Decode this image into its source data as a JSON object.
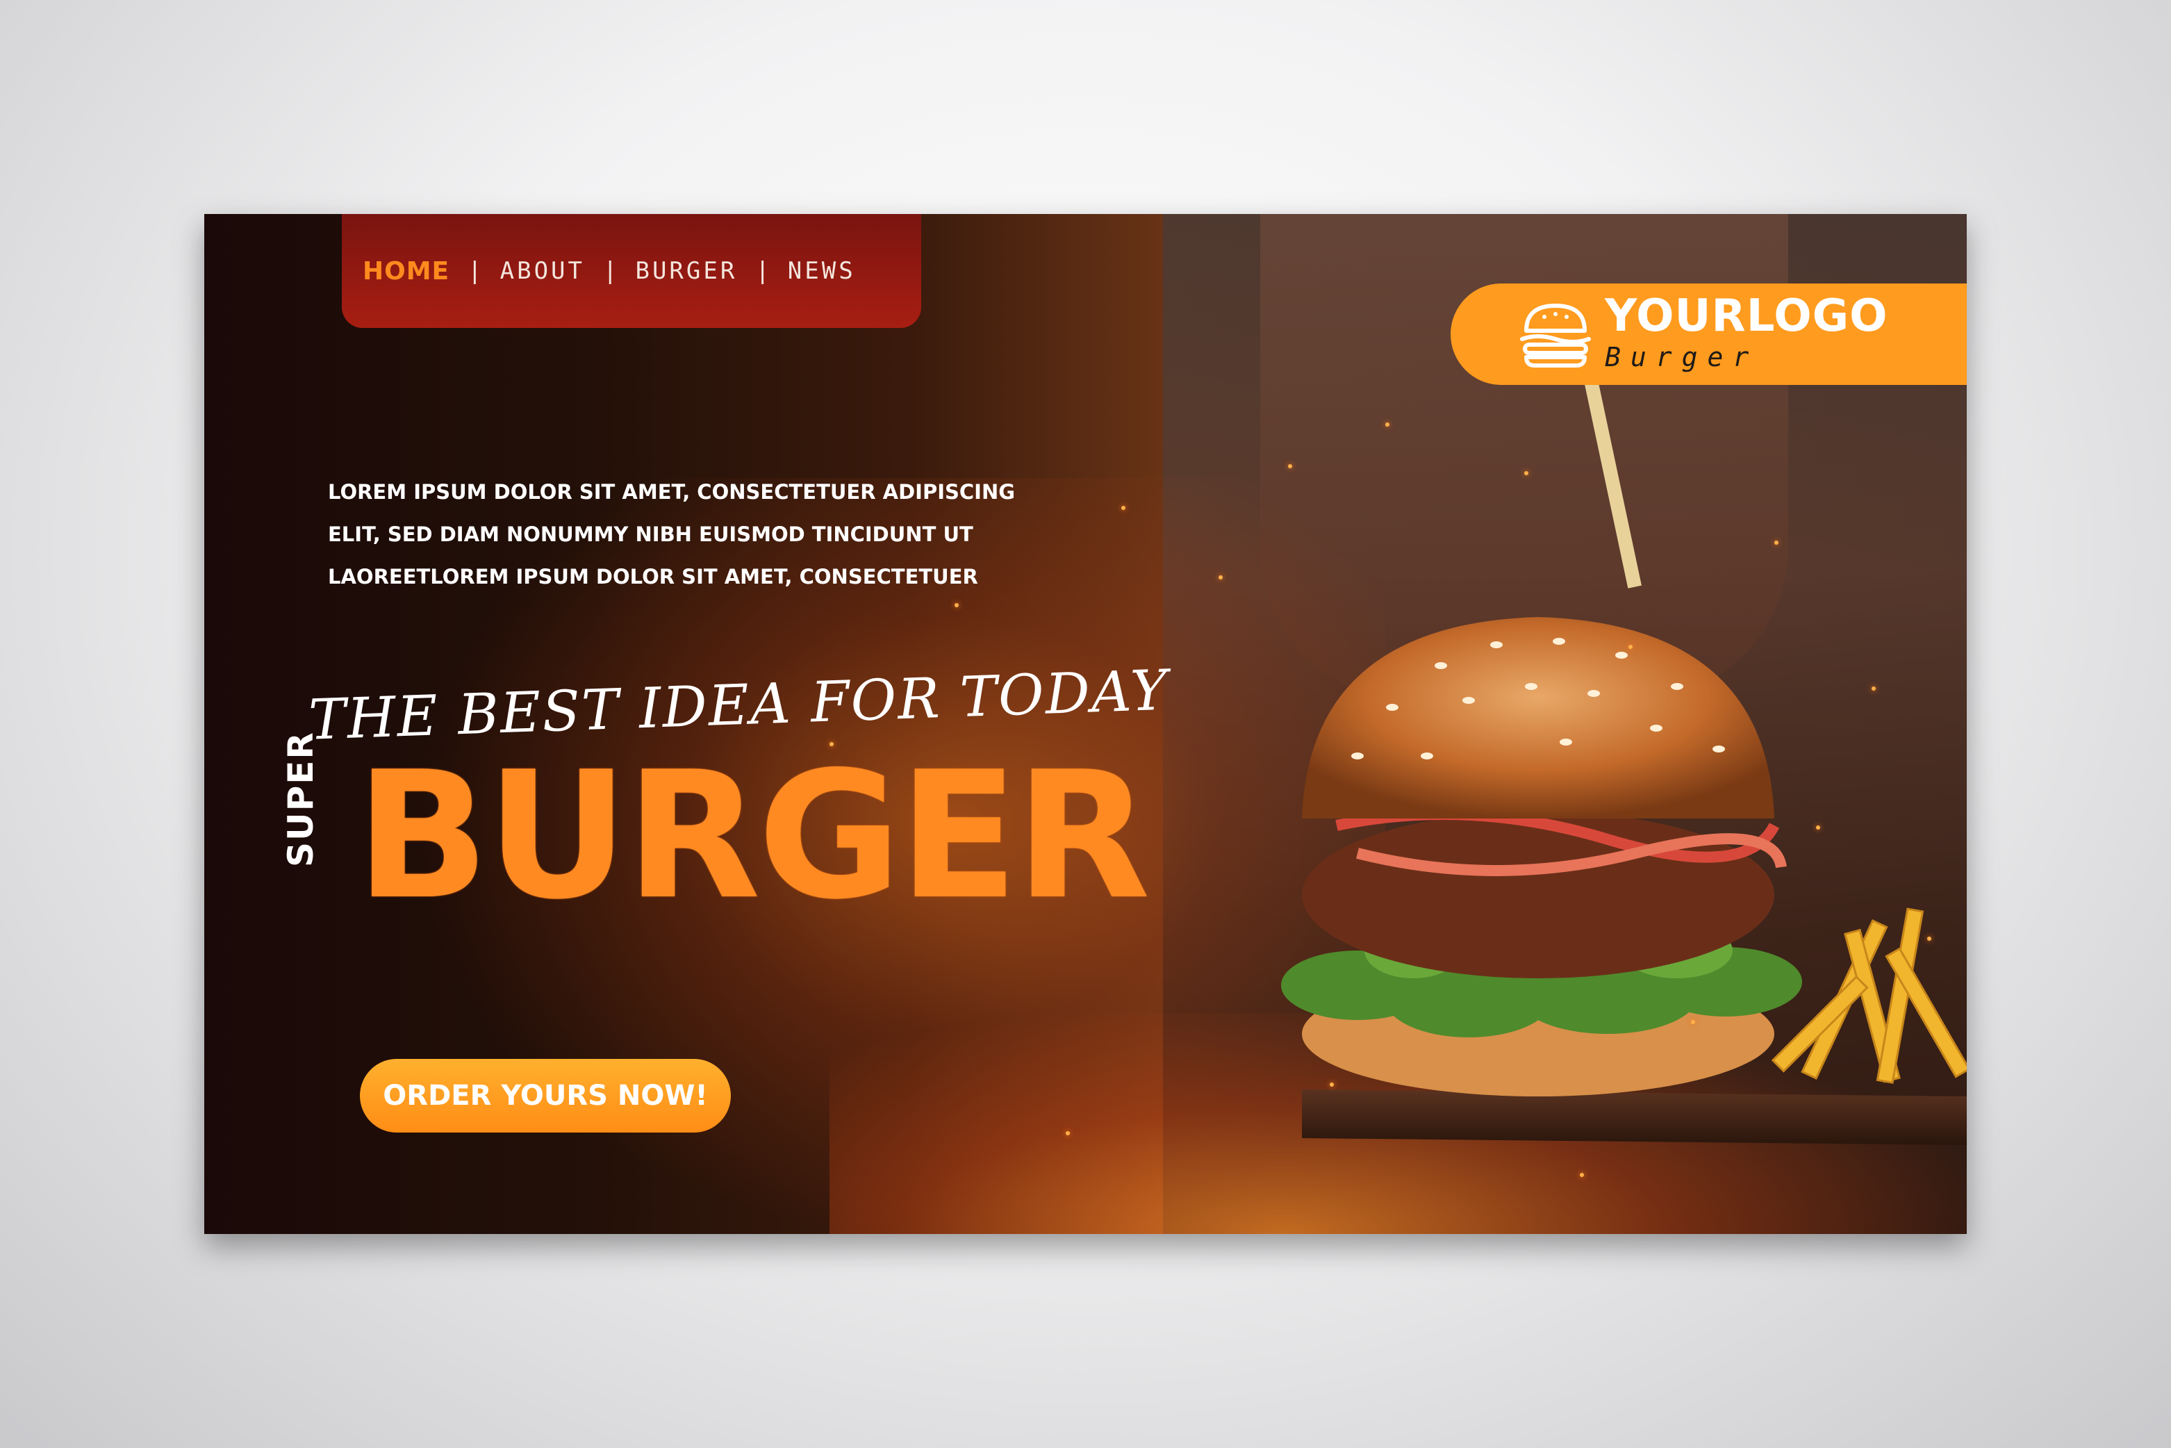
{
  "nav": {
    "items": [
      {
        "label": "HOME",
        "active": true
      },
      {
        "label": "ABOUT",
        "active": false
      },
      {
        "label": "BURGER",
        "active": false
      },
      {
        "label": "NEWS",
        "active": false
      }
    ],
    "separator": "|"
  },
  "logo": {
    "title": "YOURLOGO",
    "subtitle": "Burger",
    "icon": "burger-icon"
  },
  "hero": {
    "intro_lines": [
      "LOREM IPSUM DOLOR SIT AMET, CONSECTETUER ADIPISCING",
      "ELIT, SED DIAM NONUMMY NIBH EUISMOD TINCIDUNT UT",
      "LAOREETLOREM IPSUM DOLOR SIT AMET, CONSECTETUER"
    ],
    "tagline": "THE BEST IDEA FOR TODAY",
    "super_label": "SUPER",
    "headline": "BURGER",
    "cta_label": "ORDER YOURS NOW!"
  },
  "colors": {
    "accent_orange": "#ff8a22",
    "nav_red": "#a81e12",
    "logo_orange": "#ff9b1e",
    "background_dark": "#1a0908"
  }
}
